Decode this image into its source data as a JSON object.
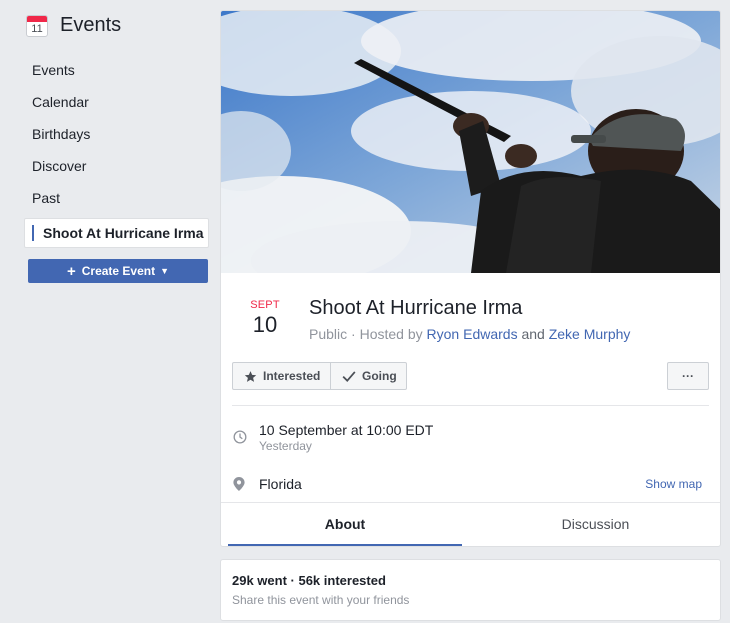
{
  "sidebar": {
    "icon_day": "11",
    "title": "Events",
    "items": [
      {
        "label": "Events"
      },
      {
        "label": "Calendar"
      },
      {
        "label": "Birthdays"
      },
      {
        "label": "Discover"
      },
      {
        "label": "Past"
      },
      {
        "label": "Shoot At Hurricane Irma"
      }
    ],
    "create_button": "Create Event"
  },
  "event": {
    "month": "SEPT",
    "day": "10",
    "title": "Shoot At Hurricane Irma",
    "privacy": "Public",
    "hosted_by_prefix": "Hosted by",
    "host1": "Ryon Edwards",
    "and": "and",
    "host2": "Zeke Murphy",
    "buttons": {
      "interested": "Interested",
      "going": "Going",
      "more": "···"
    },
    "time": "10 September at 10:00 EDT",
    "time_relative": "Yesterday",
    "location": "Florida",
    "show_map": "Show map",
    "tabs": [
      "About",
      "Discussion"
    ]
  },
  "summary": {
    "stats": "29k went · 56k interested",
    "share": "Share this event with your friends"
  },
  "colors": {
    "accent": "#4267b2",
    "month_red": "#f02849",
    "background": "#e9ebee"
  },
  "icons": [
    "calendar-icon",
    "star-icon",
    "check-icon",
    "clock-icon",
    "location-pin-icon",
    "caret-down-icon"
  ]
}
